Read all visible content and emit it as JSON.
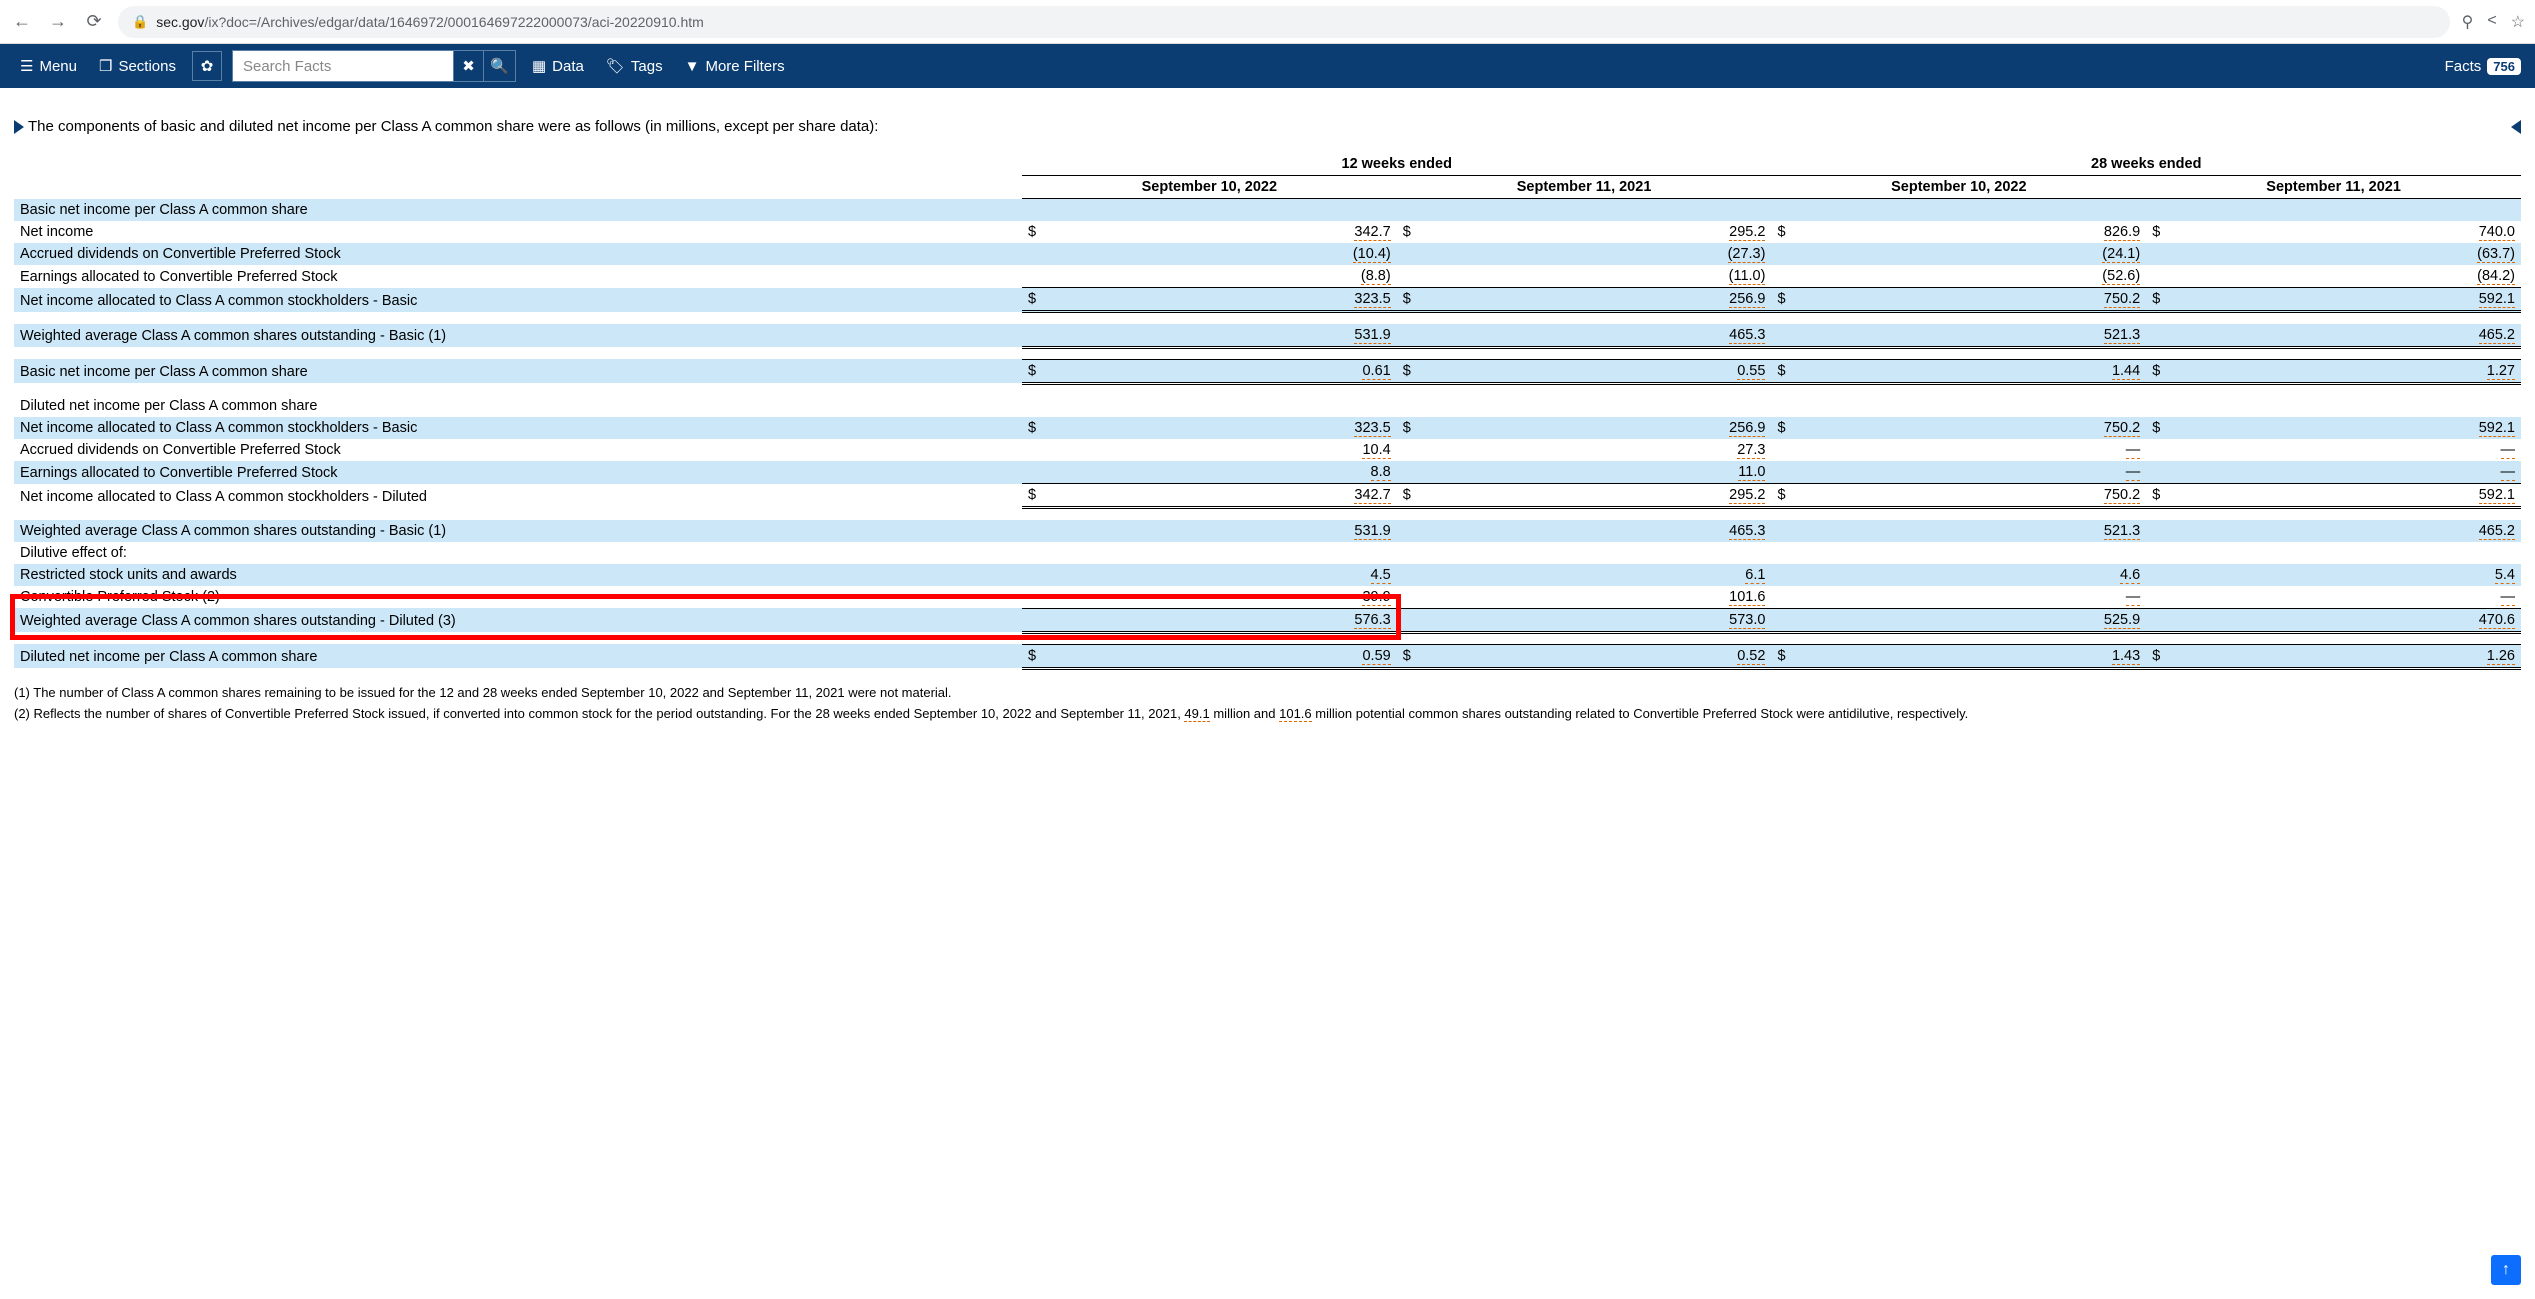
{
  "browser": {
    "url_host": "sec.gov",
    "url_path": "/ix?doc=/Archives/edgar/data/1646972/000164697222000073/aci-20220910.htm"
  },
  "toolbar": {
    "menu": "Menu",
    "sections": "Sections",
    "search_placeholder": "Search Facts",
    "data": "Data",
    "tags": "Tags",
    "more_filters": "More Filters",
    "facts_label": "Facts",
    "facts_count": "756"
  },
  "intro": "The components of basic and diluted net income per Class A common share were as follows (in millions, except per share data):",
  "periods": {
    "p12": "12 weeks ended",
    "p28": "28 weeks ended",
    "d1": "September 10, 2022",
    "d2": "September 11, 2021",
    "d3": "September 10, 2022",
    "d4": "September 11, 2021"
  },
  "rows": {
    "basic_hdr": "Basic net income per Class A common share",
    "net_income": {
      "label": "Net income",
      "v": [
        "342.7",
        "295.2",
        "826.9",
        "740.0"
      ]
    },
    "accrued_div": {
      "label": "Accrued dividends on Convertible Preferred Stock",
      "v": [
        "(10.4)",
        "(27.3)",
        "(24.1)",
        "(63.7)"
      ]
    },
    "earn_alloc": {
      "label": "Earnings allocated to Convertible Preferred Stock",
      "v": [
        "(8.8)",
        "(11.0)",
        "(52.6)",
        "(84.2)"
      ]
    },
    "ni_basic": {
      "label": "Net income allocated to Class A common stockholders - Basic",
      "v": [
        "323.5",
        "256.9",
        "750.2",
        "592.1"
      ]
    },
    "wavg_basic": {
      "label": "Weighted average Class A common shares outstanding - Basic (1)",
      "v": [
        "531.9",
        "465.3",
        "521.3",
        "465.2"
      ]
    },
    "basic_eps": {
      "label": "Basic net income per Class A common share",
      "v": [
        "0.61",
        "0.55",
        "1.44",
        "1.27"
      ]
    },
    "diluted_hdr": "Diluted net income per Class A common share",
    "ni_basic2": {
      "label": "Net income allocated to Class A common stockholders - Basic",
      "v": [
        "323.5",
        "256.9",
        "750.2",
        "592.1"
      ]
    },
    "accrued_div2": {
      "label": "Accrued dividends on Convertible Preferred Stock",
      "v": [
        "10.4",
        "27.3",
        "—",
        "—"
      ]
    },
    "earn_alloc2": {
      "label": "Earnings allocated to Convertible Preferred Stock",
      "v": [
        "8.8",
        "11.0",
        "—",
        "—"
      ]
    },
    "ni_diluted": {
      "label": "Net income allocated to Class A common stockholders - Diluted",
      "v": [
        "342.7",
        "295.2",
        "750.2",
        "592.1"
      ]
    },
    "wavg_basic2": {
      "label": "Weighted average Class A common shares outstanding - Basic (1)",
      "v": [
        "531.9",
        "465.3",
        "521.3",
        "465.2"
      ]
    },
    "dilutive_hdr": "Dilutive effect of:",
    "rsu": {
      "label": "Restricted stock units and awards",
      "v": [
        "4.5",
        "6.1",
        "4.6",
        "5.4"
      ]
    },
    "conv_pref": {
      "label": "Convertible Preferred Stock (2)",
      "v": [
        "39.9",
        "101.6",
        "—",
        "—"
      ]
    },
    "wavg_diluted": {
      "label": "Weighted average Class A common shares outstanding - Diluted (3)",
      "v": [
        "576.3",
        "573.0",
        "525.9",
        "470.6"
      ]
    },
    "diluted_eps": {
      "label": "Diluted net income per Class A common share",
      "v": [
        "0.59",
        "0.52",
        "1.43",
        "1.26"
      ]
    }
  },
  "footnotes": {
    "f1": "(1) The number of Class A common shares remaining to be issued for the 12 and 28 weeks ended September 10, 2022 and September 11, 2021 were not material.",
    "f2_a": "(2) Reflects the number of shares of Convertible Preferred Stock issued, if converted into common stock for the period outstanding. For the 28 weeks ended September 10, 2022 and September 11, 2021, ",
    "f2_v1": "49.1",
    "f2_b": " million and ",
    "f2_v2": "101.6",
    "f2_c": " million potential common shares outstanding related to Convertible Preferred Stock were antidilutive, respectively."
  }
}
